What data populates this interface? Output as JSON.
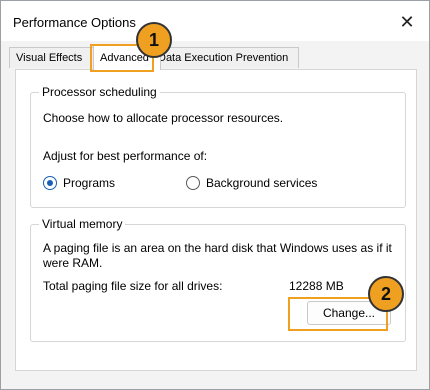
{
  "window": {
    "title": "Performance Options",
    "close_glyph": "✕"
  },
  "tabs": [
    "Visual Effects",
    "Advanced",
    "Data Execution Prevention"
  ],
  "processor": {
    "legend": "Processor scheduling",
    "description": "Choose how to allocate processor resources.",
    "adjust_label": "Adjust for best performance of:",
    "options": [
      {
        "label": "Programs",
        "selected": true
      },
      {
        "label": "Background services",
        "selected": false
      }
    ]
  },
  "virtual_memory": {
    "legend": "Virtual memory",
    "description_line1": "A paging file is an area on the hard disk that Windows uses as if it",
    "description_line2": "were RAM.",
    "total_label": "Total paging file size for all drives:",
    "total_value": "12288 MB",
    "change_button": "Change..."
  },
  "annotations": {
    "step1": "1",
    "step2": "2",
    "accent": "#f0a020"
  }
}
